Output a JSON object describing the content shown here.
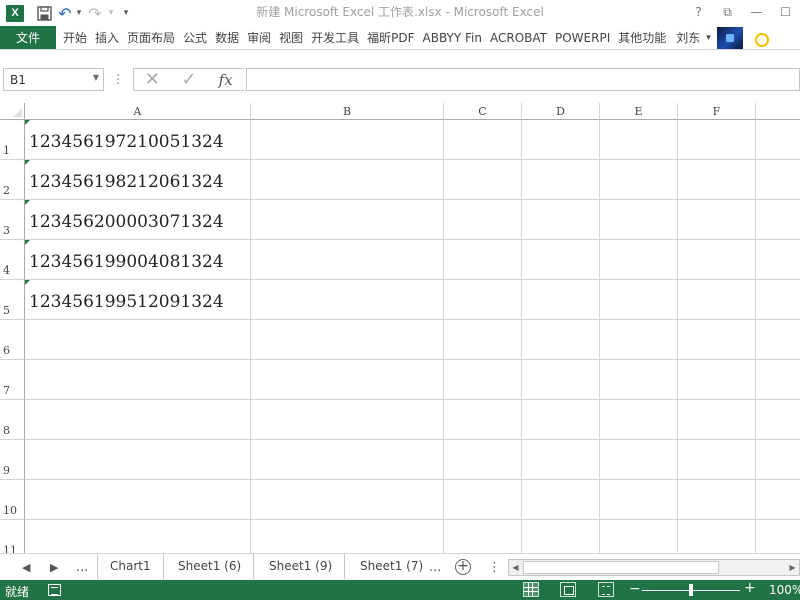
{
  "window": {
    "title": "新建 Microsoft Excel 工作表.xlsx - Microsoft Excel",
    "app_icon": "X",
    "controls": {
      "help": "?",
      "restore_ribbon": "⧉",
      "minimize": "—",
      "maximize": "☐",
      "close": "✕"
    }
  },
  "qat": {
    "save": "save-icon",
    "undo": "↶",
    "undo_dd": "▾",
    "redo": "↷",
    "redo_dd": "▾",
    "customize": "▾"
  },
  "ribbon": {
    "file": "文件",
    "tabs": [
      "开始",
      "插入",
      "页面布局",
      "公式",
      "数据",
      "审阅",
      "视图",
      "开发工具",
      "福昕PDF",
      "ABBYY Fin",
      "ACROBAT",
      "POWERPI",
      "其他功能"
    ],
    "user": "刘东",
    "user_dd": "▾"
  },
  "formula_bar": {
    "name_box": "B1",
    "dots": "⋮",
    "cancel": "✕",
    "enter": "✓",
    "fx": "fx",
    "formula": ""
  },
  "grid": {
    "columns": [
      "A",
      "B",
      "C",
      "D",
      "E",
      "F"
    ],
    "rows": [
      "1",
      "2",
      "3",
      "4",
      "5",
      "6",
      "7",
      "8",
      "9",
      "10",
      "11"
    ],
    "cells_col_a": [
      "123456197210051324",
      "123456198212061324",
      "123456200003071324",
      "123456199004081324",
      "123456199512091324"
    ],
    "selected_cell": "B1"
  },
  "sheets": {
    "nav_prev": "◀",
    "nav_next": "▶",
    "more_left": "...",
    "tabs": [
      "Chart1",
      "Sheet1 (6)",
      "Sheet1 (9)",
      "Sheet1 (7)"
    ],
    "more_right": "...",
    "add": "+",
    "options": "⋮"
  },
  "status": {
    "ready": "就绪",
    "zoom_minus": "−",
    "zoom_plus": "+",
    "zoom": "100%"
  },
  "colors": {
    "accent": "#217346",
    "gridline": "#d4d4d4",
    "error_flag": "#1e7d3a"
  }
}
